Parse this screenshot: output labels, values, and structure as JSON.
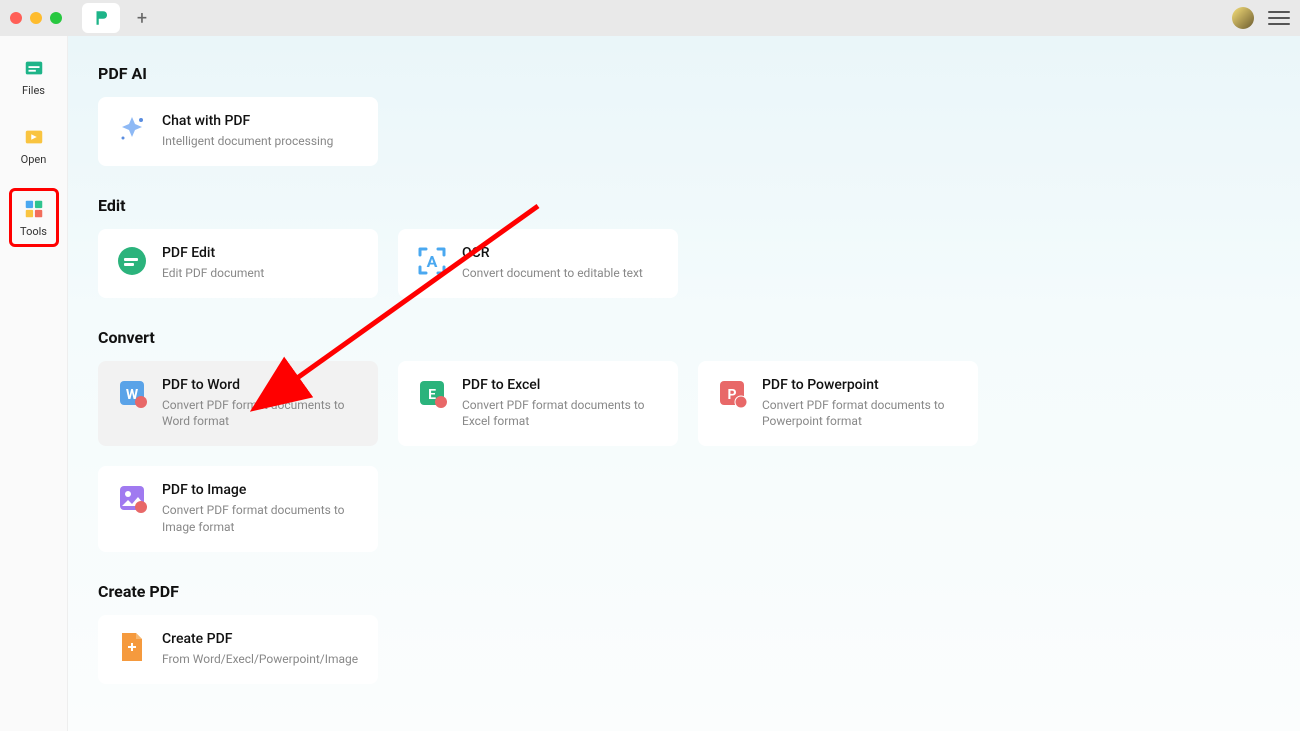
{
  "sidebar": {
    "items": [
      {
        "label": "Files"
      },
      {
        "label": "Open"
      },
      {
        "label": "Tools"
      }
    ]
  },
  "sections": {
    "ai": {
      "title": "PDF AI",
      "cards": [
        {
          "title": "Chat with PDF",
          "desc": "Intelligent document processing"
        }
      ]
    },
    "edit": {
      "title": "Edit",
      "cards": [
        {
          "title": "PDF Edit",
          "desc": "Edit PDF document"
        },
        {
          "title": "OCR",
          "desc": "Convert document to editable text"
        }
      ]
    },
    "convert": {
      "title": "Convert",
      "cards": [
        {
          "title": "PDF to Word",
          "desc": "Convert PDF format documents to Word format"
        },
        {
          "title": "PDF to Excel",
          "desc": "Convert PDF format documents to Excel format"
        },
        {
          "title": "PDF to Powerpoint",
          "desc": "Convert PDF format documents to Powerpoint format"
        },
        {
          "title": "PDF to Image",
          "desc": "Convert PDF format documents to Image format"
        }
      ]
    },
    "create": {
      "title": "Create PDF",
      "cards": [
        {
          "title": "Create PDF",
          "desc": "From Word/Execl/Powerpoint/Image"
        }
      ]
    }
  }
}
